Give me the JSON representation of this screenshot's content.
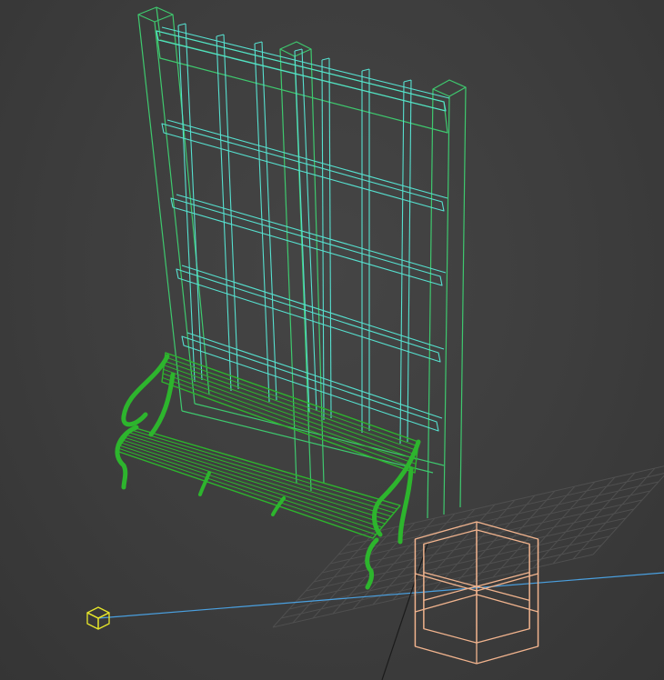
{
  "viewport": {
    "background_color": "#3d3d3d",
    "grid_color": "#4f4f4f",
    "axis_x_color": "#4aa0e0",
    "axis_y_color": "#1a1a1a"
  },
  "objects": [
    {
      "name": "trellis-frame",
      "wire_color": "#3ec86e"
    },
    {
      "name": "trellis-lattice",
      "wire_color": "#56e0cf"
    },
    {
      "name": "park-bench",
      "wire_color": "#2db52d"
    },
    {
      "name": "hexagonal-planter",
      "wire_color": "#f2b48e"
    },
    {
      "name": "light-gizmo",
      "wire_color": "#e6e62a"
    }
  ]
}
